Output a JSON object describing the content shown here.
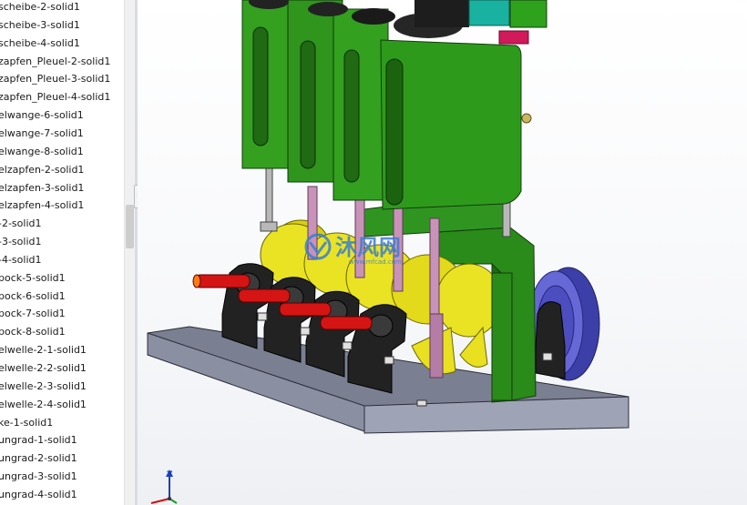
{
  "feature_tree": {
    "items": [
      "scheibe-2-solid1",
      "scheibe-3-solid1",
      "scheibe-4-solid1",
      "zapfen_Pleuel-2-solid1",
      "zapfen_Pleuel-3-solid1",
      "zapfen_Pleuel-4-solid1",
      "elwange-6-solid1",
      "elwange-7-solid1",
      "elwange-8-solid1",
      "elzapfen-2-solid1",
      "elzapfen-3-solid1",
      "elzapfen-4-solid1",
      "-2-solid1",
      "-3-solid1",
      "-4-solid1",
      "bock-5-solid1",
      "bock-6-solid1",
      "bock-7-solid1",
      "bock-8-solid1",
      "elwelle-2-1-solid1",
      "elwelle-2-2-solid1",
      "elwelle-2-3-solid1",
      "elwelle-2-4-solid1",
      "ke-1-solid1",
      "ungrad-1-solid1",
      "ungrad-2-solid1",
      "ungrad-3-solid1",
      "ungrad-4-solid1"
    ]
  },
  "splitter": {
    "arrow": "›"
  },
  "triad": {
    "z_label": "Z"
  },
  "watermark": {
    "text": "沐风网",
    "sub": "www.mfcad.com"
  },
  "colors": {
    "cylinder_green": "#2f8f1c",
    "crank_yellow": "#e8e020",
    "bearing_black": "#222222",
    "base_plate": "#6d7184",
    "shaft_red": "#d31414",
    "flywheel_blue": "#5a5cc8",
    "conrod_pink": "#c992b8",
    "watermark": "#3a7fd0"
  }
}
